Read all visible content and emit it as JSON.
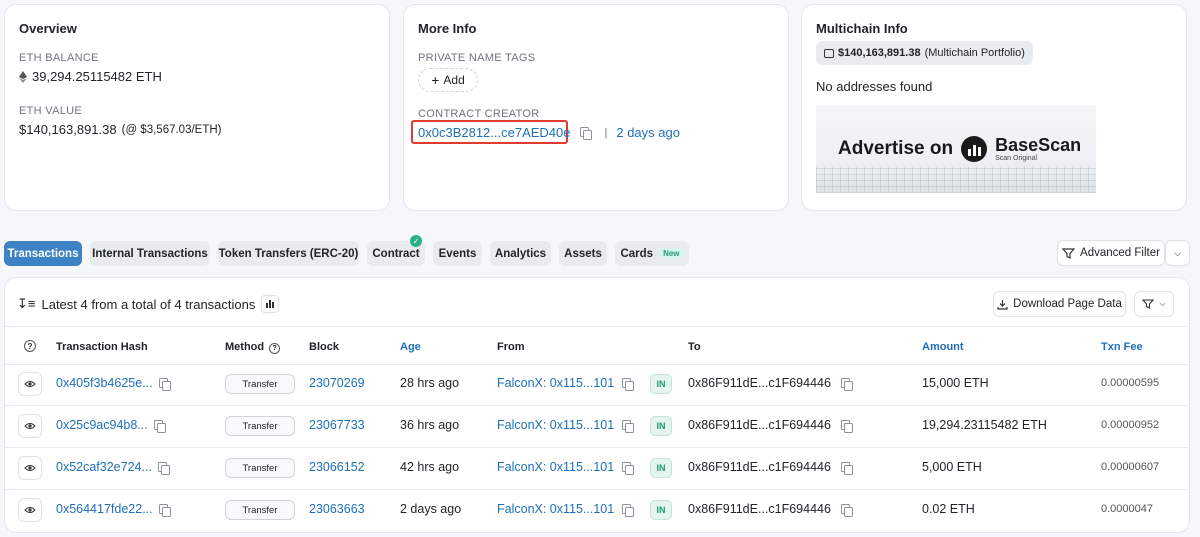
{
  "overview": {
    "title": "Overview",
    "eth_balance_label": "ETH BALANCE",
    "eth_balance": "39,294.25115482 ETH",
    "eth_value_label": "ETH VALUE",
    "eth_value": "$140,163,891.38",
    "eth_value_rate": "(@ $3,567.03/ETH)"
  },
  "more_info": {
    "title": "More Info",
    "private_tags_label": "PRIVATE NAME TAGS",
    "add_label": "Add",
    "creator_label": "CONTRACT CREATOR",
    "creator_address": "0x0c3B2812...ce7AED40e",
    "creator_sep": "|",
    "creator_age": "2 days ago"
  },
  "multichain": {
    "title": "Multichain Info",
    "portfolio_value": "$140,163,891.38",
    "portfolio_suffix": "(Multichain Portfolio)",
    "no_addresses": "No addresses found",
    "ad_text": "Advertise on",
    "ad_brand": "BaseScan",
    "ad_sub": "Scan Original"
  },
  "tabs": [
    {
      "label": "Transactions"
    },
    {
      "label": "Internal Transactions"
    },
    {
      "label": "Token Transfers (ERC-20)"
    },
    {
      "label": "Contract"
    },
    {
      "label": "Events"
    },
    {
      "label": "Analytics"
    },
    {
      "label": "Assets"
    },
    {
      "label": "Cards",
      "badge": "New"
    }
  ],
  "advanced_filter": "Advanced Filter",
  "summary": "Latest 4 from a total of 4 transactions",
  "download": "Download Page Data",
  "columns": {
    "hash": "Transaction Hash",
    "method": "Method",
    "block": "Block",
    "age": "Age",
    "from": "From",
    "to": "To",
    "amount": "Amount",
    "fee": "Txn Fee"
  },
  "rows": [
    {
      "hash": "0x405f3b4625e...",
      "method": "Transfer",
      "block": "23070269",
      "age": "28 hrs ago",
      "from": "FalconX: 0x115...101",
      "dir": "IN",
      "to": "0x86F911dE...c1F694446",
      "amount": "15,000 ETH",
      "fee": "0.00000595"
    },
    {
      "hash": "0x25c9ac94b8...",
      "method": "Transfer",
      "block": "23067733",
      "age": "36 hrs ago",
      "from": "FalconX: 0x115...101",
      "dir": "IN",
      "to": "0x86F911dE...c1F694446",
      "amount": "19,294.23115482 ETH",
      "fee": "0.00000952"
    },
    {
      "hash": "0x52caf32e724...",
      "method": "Transfer",
      "block": "23066152",
      "age": "42 hrs ago",
      "from": "FalconX: 0x115...101",
      "dir": "IN",
      "to": "0x86F911dE...c1F694446",
      "amount": "5,000 ETH",
      "fee": "0.00000607"
    },
    {
      "hash": "0x564417fde22...",
      "method": "Transfer",
      "block": "23063663",
      "age": "2 days ago",
      "from": "FalconX: 0x115...101",
      "dir": "IN",
      "to": "0x86F911dE...c1F694446",
      "amount": "0.02 ETH",
      "fee": "0.0000047"
    }
  ],
  "colors": {
    "accent": "#3c82c4",
    "link": "#1e6fb8",
    "highlight": "#e03b2e",
    "in_badge": "#1f9a70"
  }
}
